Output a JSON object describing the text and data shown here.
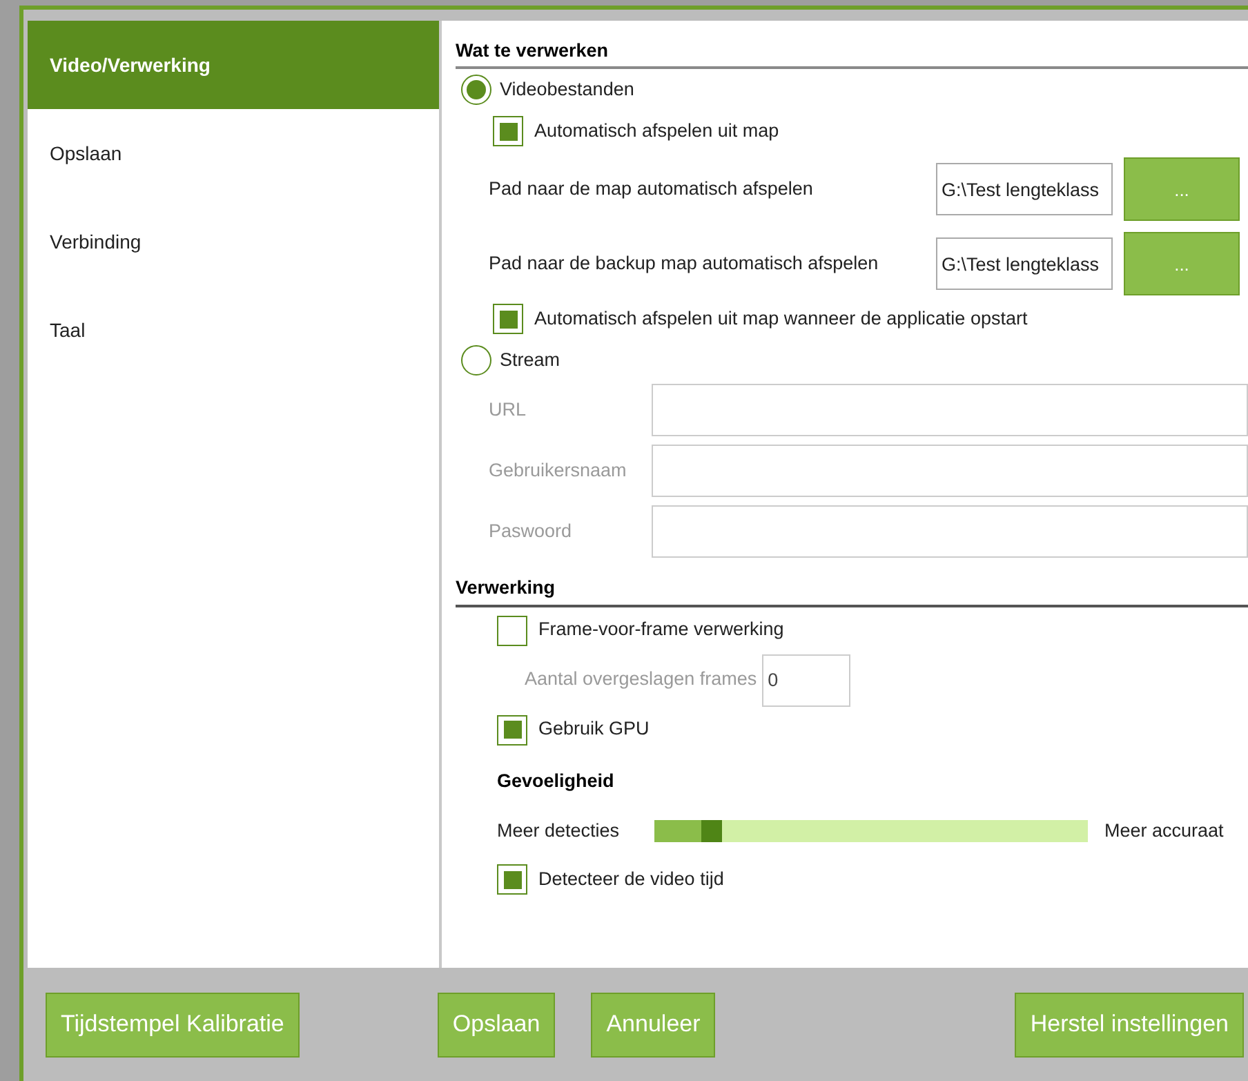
{
  "sidebar": {
    "items": [
      {
        "label": "Video/Verwerking",
        "selected": true
      },
      {
        "label": "Opslaan",
        "selected": false
      },
      {
        "label": "Verbinding",
        "selected": false
      },
      {
        "label": "Taal",
        "selected": false
      }
    ]
  },
  "source_section": {
    "title": "Wat te verwerken",
    "video_option": {
      "label": "Videobestanden",
      "selected": true
    },
    "autoplay": {
      "label": "Automatisch afspelen uit map",
      "checked": true
    },
    "paths": [
      {
        "label": "Pad naar de map automatisch afspelen",
        "value": "G:\\Test lengteklass",
        "button": "..."
      },
      {
        "label": "Pad naar de backup map automatisch afspelen",
        "value": "G:\\Test lengteklass",
        "button": "..."
      }
    ],
    "autoplay_startup": {
      "label": "Automatisch afspelen uit map wanneer de applicatie opstart",
      "checked": true
    },
    "stream_option": {
      "label": "Stream",
      "selected": false
    },
    "stream_fields": [
      {
        "label": "URL",
        "disabled": true
      },
      {
        "label": "Gebruikersnaam",
        "disabled": true
      },
      {
        "label": "Paswoord",
        "disabled": true
      }
    ]
  },
  "processing_section": {
    "title": "Verwerking",
    "frame_by_frame": {
      "label": "Frame-voor-frame verwerking",
      "checked": false
    },
    "skipped_frames": {
      "label": "Aantal overgeslagen frames",
      "value": "0",
      "disabled": true
    },
    "use_gpu": {
      "label": "Gebruik GPU",
      "checked": true
    },
    "sensitivity": {
      "title": "Gevoeligheid",
      "min_label": "Meer detecties",
      "max_label": "Meer accuraat",
      "level": 0.13
    },
    "detect_time": {
      "label": "Detecteer de video tijd",
      "checked": true
    }
  },
  "footer": {
    "buttons": [
      "Tijdstempel Kalibratie",
      "Opslaan",
      "Annuleer",
      "Herstel instellingen"
    ]
  }
}
